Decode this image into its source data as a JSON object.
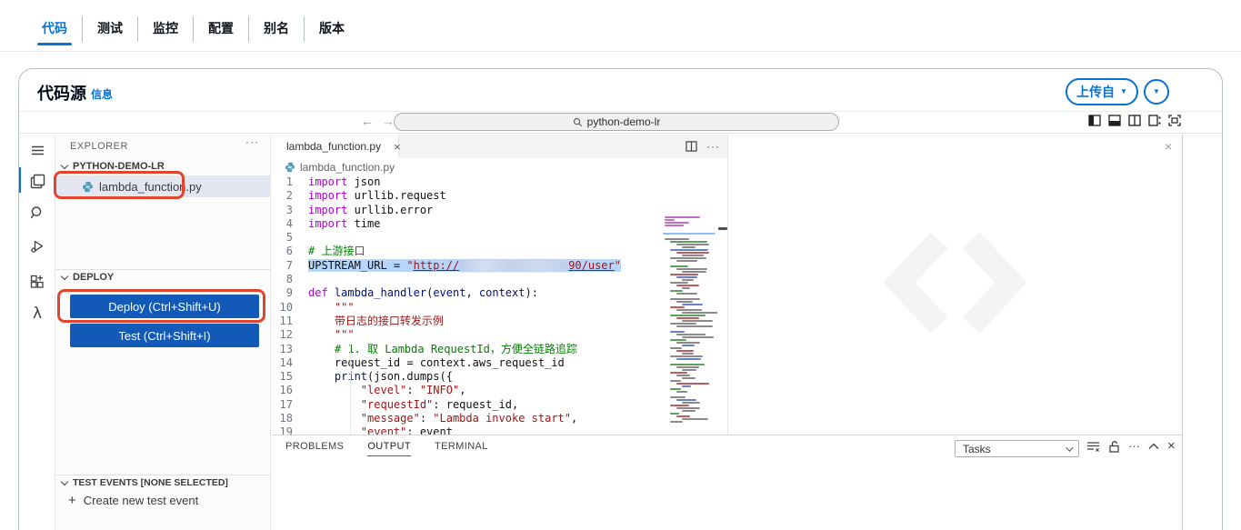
{
  "function_tabs": {
    "items": [
      {
        "label": "代码",
        "active": true
      },
      {
        "label": "测试",
        "active": false
      },
      {
        "label": "监控",
        "active": false
      },
      {
        "label": "配置",
        "active": false
      },
      {
        "label": "别名",
        "active": false
      },
      {
        "label": "版本",
        "active": false
      }
    ]
  },
  "header": {
    "title": "代码源",
    "info_link": "信息",
    "upload_from_label": "上传自"
  },
  "nav": {
    "search_value": "python-demo-lr"
  },
  "explorer": {
    "title": "EXPLORER",
    "project_name": "PYTHON-DEMO-LR",
    "file_name": "lambda_function.py",
    "deploy": {
      "section_label": "DEPLOY",
      "deploy_button": "Deploy (Ctrl+Shift+U)",
      "test_button": "Test (Ctrl+Shift+I)"
    },
    "test_events": {
      "section_label": "TEST EVENTS [NONE SELECTED]",
      "create_label": "Create new test event"
    }
  },
  "editor": {
    "tab_label": "lambda_function.py",
    "breadcrumb": "lambda_function.py",
    "lines": [
      {
        "num": "1",
        "segments": [
          [
            "kw",
            "import"
          ],
          [
            "pl",
            " json"
          ]
        ]
      },
      {
        "num": "2",
        "segments": [
          [
            "kw",
            "import"
          ],
          [
            "pl",
            " urllib.request"
          ]
        ]
      },
      {
        "num": "3",
        "segments": [
          [
            "kw",
            "import"
          ],
          [
            "pl",
            " urllib.error"
          ]
        ]
      },
      {
        "num": "4",
        "segments": [
          [
            "kw",
            "import"
          ],
          [
            "pl",
            " time"
          ]
        ]
      },
      {
        "num": "5",
        "segments": []
      },
      {
        "num": "6",
        "segments": [
          [
            "cm",
            "# 上游接口"
          ]
        ]
      },
      {
        "num": "7",
        "selected": true,
        "segments": [
          [
            "pl",
            "UPSTREAM_URL = "
          ],
          [
            "str",
            "\""
          ],
          [
            "link",
            "http://"
          ],
          [
            "redacted",
            ""
          ],
          [
            "link",
            "90/user"
          ],
          [
            "str",
            "\""
          ]
        ]
      },
      {
        "num": "8",
        "segments": []
      },
      {
        "num": "9",
        "segments": [
          [
            "kw",
            "def"
          ],
          [
            "pl",
            " "
          ],
          [
            "fn",
            "lambda_handler"
          ],
          [
            "pl",
            "("
          ],
          [
            "param",
            "event"
          ],
          [
            "pl",
            ", "
          ],
          [
            "param",
            "context"
          ],
          [
            "pl",
            "):"
          ]
        ]
      },
      {
        "num": "10",
        "segments": [
          [
            "str",
            "    \"\"\""
          ]
        ]
      },
      {
        "num": "11",
        "segments": [
          [
            "str",
            "    带日志的接口转发示例"
          ]
        ]
      },
      {
        "num": "12",
        "segments": [
          [
            "str",
            "    \"\"\""
          ]
        ]
      },
      {
        "num": "13",
        "segments": [
          [
            "cm",
            "    # 1. 取 Lambda RequestId，方便全链路追踪"
          ]
        ]
      },
      {
        "num": "14",
        "segments": [
          [
            "pl",
            "    request_id = context.aws_request_id"
          ]
        ]
      },
      {
        "num": "15",
        "segments": [
          [
            "pl",
            "    "
          ],
          [
            "fn",
            "print"
          ],
          [
            "pl",
            "(json.dumps({"
          ]
        ]
      },
      {
        "num": "16",
        "segments": [
          [
            "pl",
            "        "
          ],
          [
            "str",
            "\"level\""
          ],
          [
            "pl",
            ": "
          ],
          [
            "str",
            "\"INFO\""
          ],
          [
            "pl",
            ","
          ]
        ]
      },
      {
        "num": "17",
        "segments": [
          [
            "pl",
            "        "
          ],
          [
            "str",
            "\"requestId\""
          ],
          [
            "pl",
            ": request_id,"
          ]
        ]
      },
      {
        "num": "18",
        "segments": [
          [
            "pl",
            "        "
          ],
          [
            "str",
            "\"message\""
          ],
          [
            "pl",
            ": "
          ],
          [
            "str",
            "\"Lambda invoke start\""
          ],
          [
            "pl",
            ","
          ]
        ]
      },
      {
        "num": "19",
        "segments": [
          [
            "pl",
            "        "
          ],
          [
            "str",
            "\"event\""
          ],
          [
            "pl",
            ": event"
          ]
        ]
      }
    ]
  },
  "bottom_panel": {
    "tabs": [
      {
        "label": "PROBLEMS",
        "active": false
      },
      {
        "label": "OUTPUT",
        "active": true
      },
      {
        "label": "TERMINAL",
        "active": false
      }
    ],
    "tasks_dropdown": "Tasks"
  },
  "glyphs": {
    "caret": "▼",
    "back": "←",
    "forward": "→",
    "close": "×",
    "more": "···",
    "plus": "+",
    "lambda": "λ"
  },
  "colors": {
    "accent": "#0972d3",
    "button_blue": "#1259b8",
    "annotation_red": "#e2452c",
    "selection": "#b5d5fb",
    "file_selected_bg": "#e4e6f1"
  }
}
